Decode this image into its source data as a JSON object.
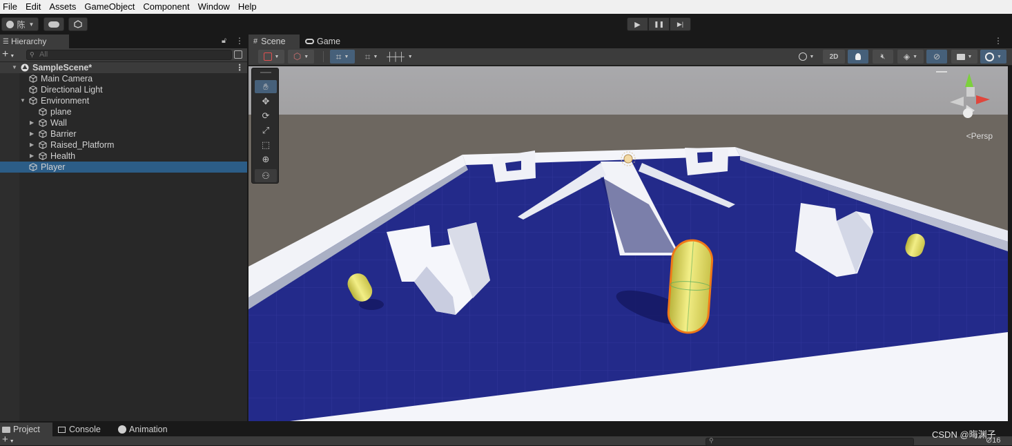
{
  "menu": [
    "File",
    "Edit",
    "Assets",
    "GameObject",
    "Component",
    "Window",
    "Help"
  ],
  "toolbar": {
    "account_label": "陈",
    "account_icon": "account-icon",
    "cloud_icon": "cloud-icon",
    "collab_icon": "collab-icon",
    "play_icon": "▶",
    "pause_icon": "❚❚",
    "step_icon": "▶|"
  },
  "hierarchy": {
    "tab_label": "Hierarchy",
    "search_placeholder": "All",
    "add_label": "+",
    "items": [
      {
        "label": "SampleScene*",
        "kind": "scene",
        "depth": 0,
        "arrow": "down"
      },
      {
        "label": "Main Camera",
        "kind": "object",
        "depth": 1,
        "arrow": ""
      },
      {
        "label": "Directional Light",
        "kind": "object",
        "depth": 1,
        "arrow": ""
      },
      {
        "label": "Environment",
        "kind": "object",
        "depth": 1,
        "arrow": "down"
      },
      {
        "label": "plane",
        "kind": "object",
        "depth": 2,
        "arrow": ""
      },
      {
        "label": "Wall",
        "kind": "object",
        "depth": 2,
        "arrow": "right"
      },
      {
        "label": "Barrier",
        "kind": "object",
        "depth": 2,
        "arrow": "right"
      },
      {
        "label": "Raised_Platform",
        "kind": "object",
        "depth": 2,
        "arrow": "right"
      },
      {
        "label": "Health",
        "kind": "object",
        "depth": 2,
        "arrow": "right"
      },
      {
        "label": "Player",
        "kind": "object",
        "depth": 1,
        "arrow": "",
        "selected": true
      }
    ]
  },
  "scene_view": {
    "tabs": [
      {
        "label": "Scene",
        "icon": "#",
        "active": true
      },
      {
        "label": "Game",
        "icon": "gamepad-icon",
        "active": false
      }
    ],
    "toggle_2d": "2D",
    "persp_label": "<Persp",
    "tools": [
      "hand-tool",
      "move-tool",
      "rotate-tool",
      "scale-tool",
      "rect-tool",
      "transform-tool",
      "custom-tool"
    ]
  },
  "bottom": {
    "tabs": [
      {
        "label": "Project",
        "active": true
      },
      {
        "label": "Console",
        "active": false
      },
      {
        "label": "Animation",
        "active": false
      }
    ],
    "hidden_count": "16"
  },
  "watermark": "CSDN @晦渊子",
  "colors": {
    "selection": "#2c5d87",
    "ground": "#23288a",
    "wall": "#eef0f6",
    "capsule": "#e8e46a",
    "player_outline": "#f07818"
  }
}
